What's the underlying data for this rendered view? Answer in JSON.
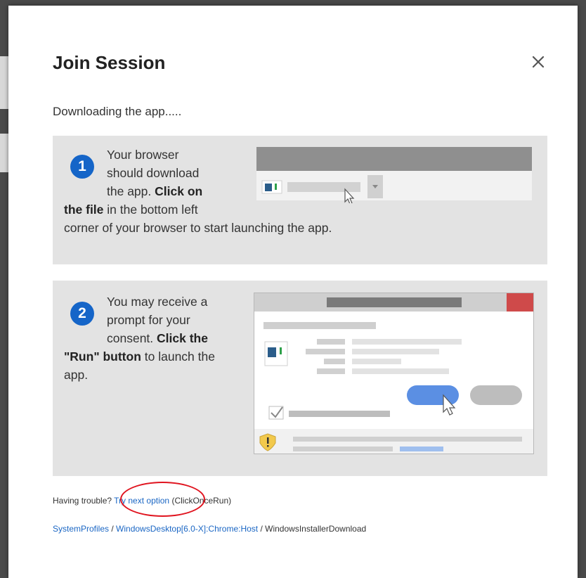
{
  "dialog": {
    "title": "Join Session",
    "status": "Downloading the app.....",
    "close_icon": "close-icon"
  },
  "steps": [
    {
      "number": "1",
      "lines_intro": [
        "Your browser",
        "should download"
      ],
      "line3_pre": "the app. ",
      "line3_bold": "Click on",
      "line4_bold": "the file",
      "line4_rest": " in the bottom left",
      "line5": "corner of your browser to start launching the app."
    },
    {
      "number": "2",
      "lines_intro": [
        "You may receive a",
        "prompt for your"
      ],
      "line3_pre": "consent. ",
      "line3_bold": "Click the",
      "line4_bold": "\"Run\" button",
      "line4_rest": " to launch the",
      "line5": "app."
    }
  ],
  "trouble": {
    "prefix": "Having trouble? ",
    "link": "Try next option",
    "suffix": " (ClickOnceRun)"
  },
  "breadcrumb": {
    "items": [
      "SystemProfiles",
      "WindowsDesktop[6.0-X]:Chrome:Host",
      "WindowsInstallerDownload"
    ],
    "separator": " / "
  },
  "colors": {
    "accent_blue": "#1565c8",
    "link_blue": "#1a66c4",
    "annotation_red": "#e0141f",
    "panel_gray": "#e3e3e3"
  }
}
